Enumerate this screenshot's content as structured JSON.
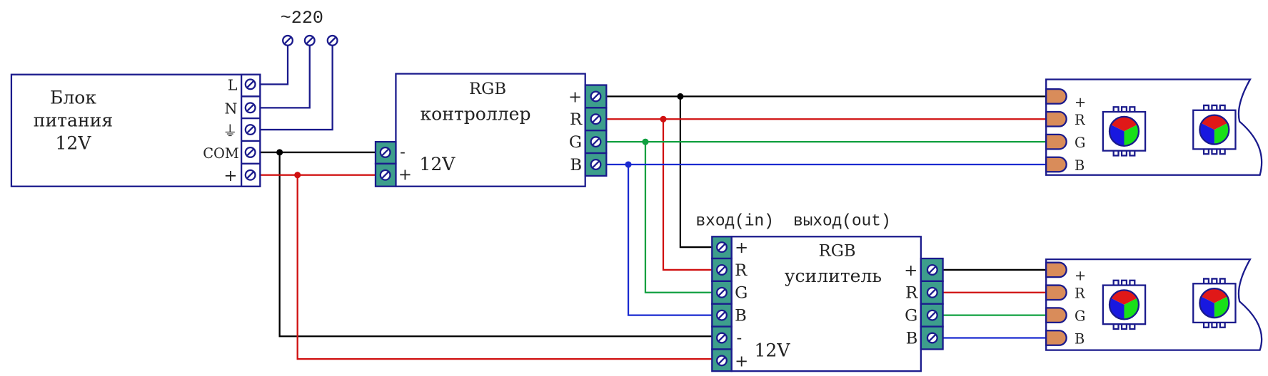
{
  "colors": {
    "outline": "#1a1a8c",
    "terminal": "#3d9e8c",
    "wire_plus": "#000000",
    "wire_r": "#d01010",
    "wire_g": "#10a040",
    "wire_b": "#1a2ad0",
    "pad": "#d98c5a"
  },
  "mains": {
    "label": "~220"
  },
  "psu": {
    "title_line1": "Блок",
    "title_line2": "питания",
    "title_line3": "12V",
    "terminals": [
      "L",
      "N",
      "⏚",
      "COM",
      "+"
    ]
  },
  "controller": {
    "title_line1": "RGB",
    "title_line2": "контроллер",
    "input_labels": [
      "-",
      "+"
    ],
    "input_voltage": "12V",
    "outputs": [
      "+",
      "R",
      "G",
      "B"
    ]
  },
  "amplifier": {
    "title_line1": "RGB",
    "title_line2": "усилитель",
    "io_label": "вход(in)  выход(out)",
    "inputs": [
      "+",
      "R",
      "G",
      "B",
      "-",
      "+"
    ],
    "input_voltage": "12V",
    "outputs": [
      "+",
      "R",
      "G",
      "B"
    ]
  },
  "strips": [
    {
      "pads": [
        "+",
        "R",
        "G",
        "B"
      ]
    },
    {
      "pads": [
        "+",
        "R",
        "G",
        "B"
      ]
    }
  ]
}
